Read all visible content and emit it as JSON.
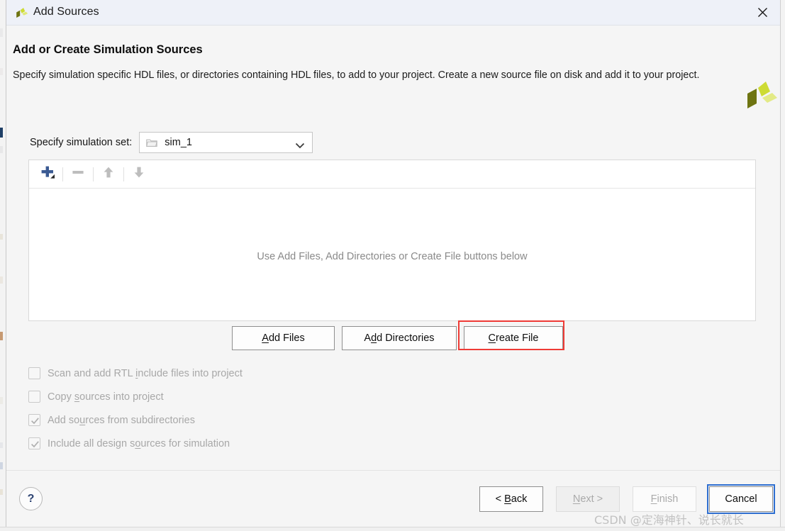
{
  "window": {
    "title": "Add Sources",
    "logo_icon": "vivado-logo-icon",
    "close_icon": "close-icon"
  },
  "header": {
    "title": "Add or Create Simulation Sources",
    "description": "Specify simulation specific HDL files, or directories containing HDL files, to add to your project. Create a new source file on disk and add it to your project.",
    "logo_icon": "vivado-logo-icon"
  },
  "simulation_set": {
    "label": "Specify simulation set:",
    "value": "sim_1",
    "folder_icon": "folder-icon",
    "chevron_icon": "chevron-down-icon"
  },
  "list_panel": {
    "toolbar": [
      {
        "name": "add-button",
        "icon": "plus-icon",
        "enabled": true
      },
      {
        "name": "remove-button",
        "icon": "minus-icon",
        "enabled": false
      },
      {
        "name": "move-up-button",
        "icon": "arrow-up-icon",
        "enabled": false
      },
      {
        "name": "move-down-button",
        "icon": "arrow-down-icon",
        "enabled": false
      }
    ],
    "empty_message": "Use Add Files, Add Directories or Create File buttons below"
  },
  "mid_buttons": {
    "add_files": {
      "pre": "A",
      "mnemonic": "",
      "label_before": "",
      "label": "Add Files",
      "m_index": 0
    },
    "add_directories": {
      "label": "Add Directories",
      "m_index": 2
    },
    "create_file": {
      "label": "Create File",
      "m_index": 0
    },
    "add_files_a": "A",
    "add_files_rest": "dd Files",
    "add_dirs_a": "A",
    "add_dirs_b": "d",
    "add_dirs_rest": "d Directories",
    "create_c": "C",
    "create_rest": "reate File"
  },
  "options": [
    {
      "name": "scan-rtl-include-checkbox",
      "before": "Scan and add RTL ",
      "mnemonic": "i",
      "after": "nclude files into project",
      "checked": false,
      "enabled": false
    },
    {
      "name": "copy-sources-checkbox",
      "before": "Copy ",
      "mnemonic": "s",
      "after": "ources into project",
      "checked": false,
      "enabled": false
    },
    {
      "name": "add-sources-subdirs-checkbox",
      "before": "Add so",
      "mnemonic": "u",
      "after": "rces from subdirectories",
      "checked": true,
      "enabled": false
    },
    {
      "name": "include-design-sources-checkbox",
      "before": "Include all design s",
      "mnemonic": "o",
      "after": "urces for simulation",
      "checked": true,
      "enabled": false
    }
  ],
  "footer": {
    "help_label": "?",
    "back": {
      "pre": "< ",
      "mnemonic": "B",
      "post": "ack",
      "enabled": true
    },
    "next": {
      "pre": "",
      "mnemonic": "N",
      "post": "ext >",
      "enabled": false
    },
    "finish": {
      "pre": "",
      "mnemonic": "F",
      "post": "inish",
      "enabled": false
    },
    "cancel": {
      "label": "Cancel",
      "enabled": true,
      "focused": true
    }
  },
  "annotation": {
    "highlight_target": "create-file-button",
    "highlight_color": "#ef3b36"
  },
  "watermark": "CSDN @定海神针、说长就长",
  "colors": {
    "titlebar_bg": "#eef1f8",
    "body_bg": "#f5f5f5",
    "panel_bg": "#ffffff",
    "accent_blue": "#2f6fd0",
    "plus_blue": "#3a5a92",
    "disabled_text": "#a8a8a8",
    "logo_dark": "#6e7411",
    "logo_bright": "#d2e13a",
    "logo_pale": "#e3ea86"
  }
}
